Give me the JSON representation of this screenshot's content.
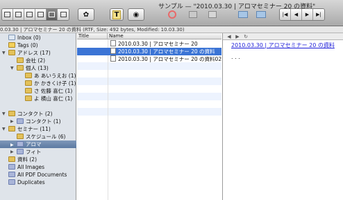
{
  "window": {
    "title": "サンプル — \"2010.03.30 | アロマセミナー 20 の資料\""
  },
  "path_info": "0.03.30 | アロマセミナー 20 の資料 (RTF, Size: 492 bytes, Modified: 10.03.30)",
  "sidebar": {
    "items": [
      {
        "label": "Inbox (0)"
      },
      {
        "label": "Tags (0)"
      },
      {
        "label": "アドレス (17)"
      },
      {
        "label": "会社 (2)"
      },
      {
        "label": "個人 (13)"
      },
      {
        "label": "あ あいうえお (1)"
      },
      {
        "label": "か かきくけ子 (1)"
      },
      {
        "label": "さ 佐藤 喜仁 (1)"
      },
      {
        "label": "よ 横山 喜仁 (1)"
      },
      {
        "label": "コンタクト (2)"
      },
      {
        "label": "コンタクト (1)"
      },
      {
        "label": "セミナー (11)"
      },
      {
        "label": "スケジュール (6)"
      },
      {
        "label": "アロマ"
      },
      {
        "label": "フィト"
      },
      {
        "label": "資料 (2)"
      },
      {
        "label": "All Images"
      },
      {
        "label": "All PDF Documents"
      },
      {
        "label": "Duplicates"
      }
    ]
  },
  "list": {
    "col_title": "Title",
    "col_name": "Name",
    "rows": [
      {
        "name": "2010.03.30 | アロマセミナー 20"
      },
      {
        "name": "2010.03.30 | アロマセミナー 20 の資料"
      },
      {
        "name": "2010.03.30 | アロマセミナー 20 の資料02"
      }
    ]
  },
  "preview": {
    "link": "2010.03.30 | アロマセミナー 20 の資料",
    "body": ". . ."
  }
}
